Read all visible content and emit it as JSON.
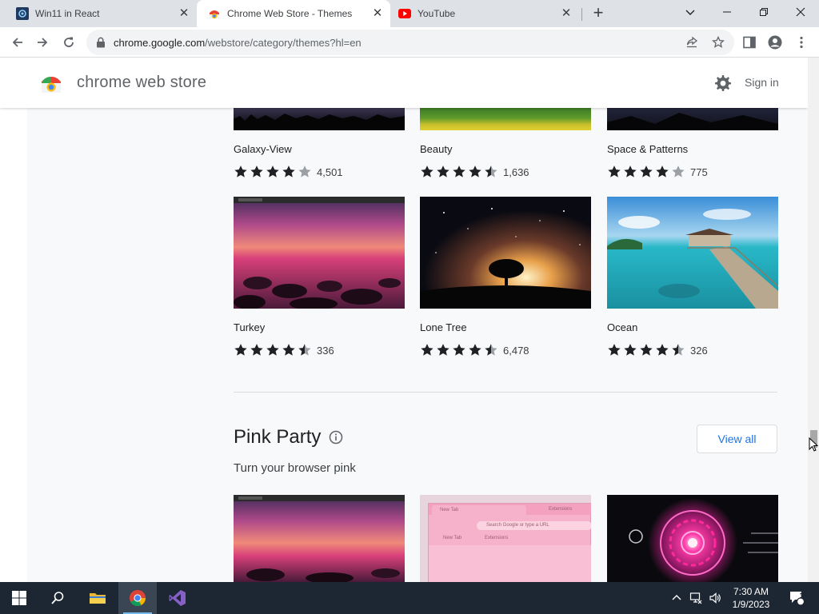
{
  "tabs": [
    {
      "title": "Win11 in React",
      "active": false
    },
    {
      "title": "Chrome Web Store - Themes",
      "active": true
    },
    {
      "title": "YouTube",
      "active": false
    }
  ],
  "address": {
    "domain": "chrome.google.com",
    "path": "/webstore/category/themes?hl=en"
  },
  "header": {
    "title": "chrome web store",
    "signin": "Sign in"
  },
  "colors": {
    "accent": "#1a73e8",
    "star": "#202124",
    "star_empty": "#9aa0a6",
    "taskbar": "#1c2733",
    "page_bg": "#f8f9fa"
  },
  "themes": [
    {
      "name": "Galaxy-View",
      "rating": 4.0,
      "count": "4,501",
      "image": "galaxy-night-scene"
    },
    {
      "name": "Beauty",
      "rating": 4.5,
      "count": "1,636",
      "image": "green-field"
    },
    {
      "name": "Space & Patterns",
      "rating": 4.0,
      "count": "775",
      "image": "mountain-night"
    },
    {
      "name": "Turkey",
      "rating": 4.5,
      "count": "336",
      "image": "pink-sunset-rocks"
    },
    {
      "name": "Lone Tree",
      "rating": 4.5,
      "count": "6,478",
      "image": "starry-sky-tree"
    },
    {
      "name": "Ocean",
      "rating": 4.5,
      "count": "326",
      "image": "tropical-pier"
    }
  ],
  "section": {
    "title": "Pink Party",
    "subtitle": "Turn your browser pink",
    "view_all": "View all",
    "previews": [
      {
        "image": "pink-sunset-rocks"
      },
      {
        "image": "pink-browser-mock",
        "mock_tab": "New Tab",
        "mock_extensions": "Extensions",
        "mock_search": "Search Google or type a URL"
      },
      {
        "image": "neon-circle-tech"
      }
    ]
  },
  "taskbar": {
    "time": "7:30 AM",
    "date": "1/9/2023",
    "notifications": "1"
  }
}
